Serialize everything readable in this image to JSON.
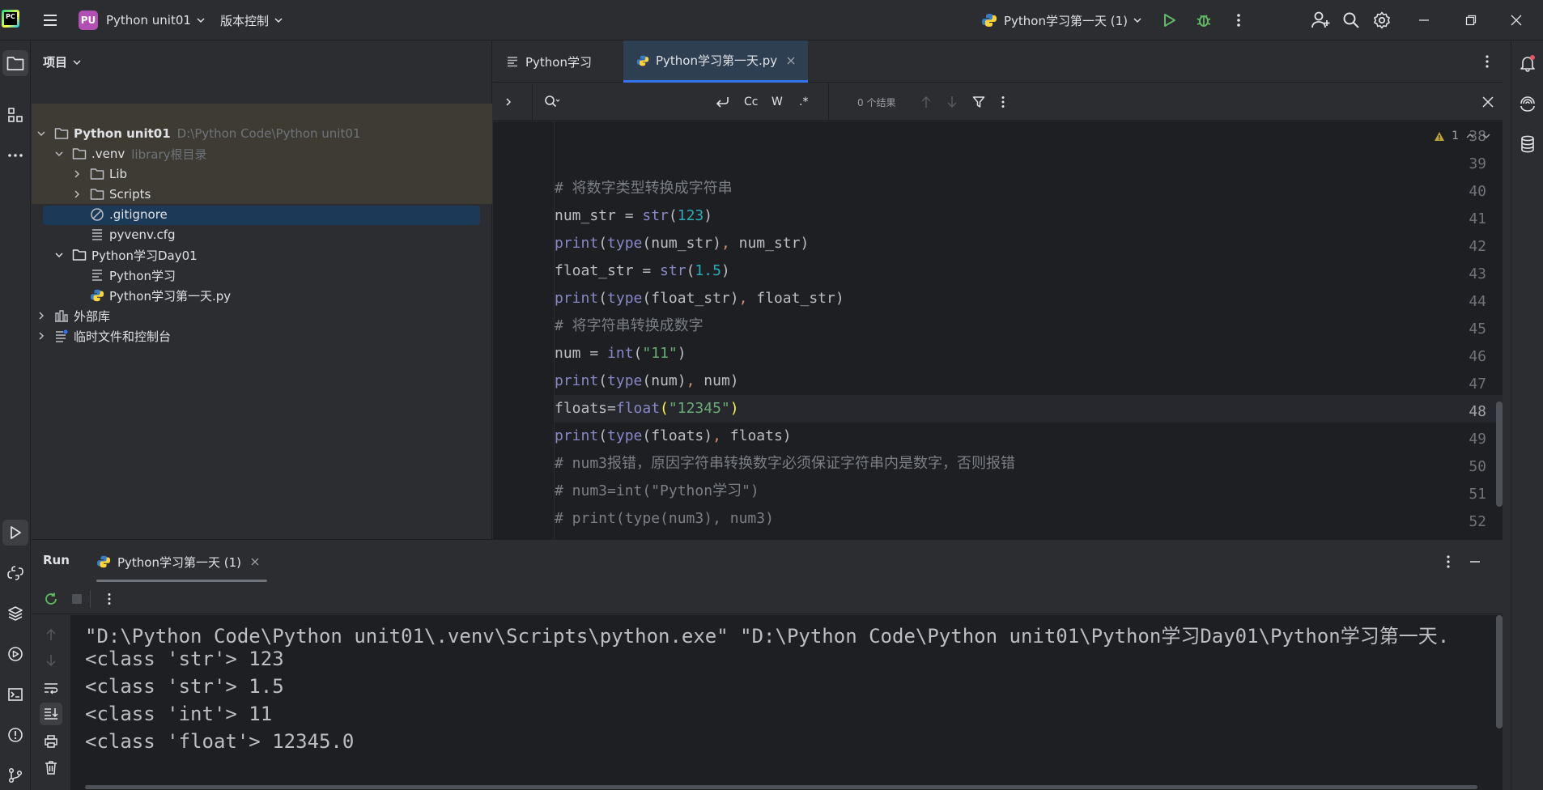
{
  "titlebar": {
    "logo_text": "PC",
    "project_badge": "PU",
    "project_name": "Python unit01",
    "vcs_menu": "版本控制",
    "run_config": "Python学习第一天 (1)"
  },
  "project_panel": {
    "header": "项目",
    "tree": [
      {
        "label": "Python unit01",
        "hint": "D:\\Python Code\\Python unit01"
      },
      {
        "label": ".venv",
        "hint": "library根目录"
      },
      {
        "label": "Lib"
      },
      {
        "label": "Scripts"
      },
      {
        "label": ".gitignore"
      },
      {
        "label": "pyvenv.cfg"
      },
      {
        "label": "Python学习Day01"
      },
      {
        "label": "Python学习"
      },
      {
        "label": "Python学习第一天.py"
      },
      {
        "label": "外部库"
      },
      {
        "label": "临时文件和控制台"
      }
    ]
  },
  "tabs": [
    {
      "label": "Python学习"
    },
    {
      "label": "Python学习第一天.py"
    }
  ],
  "findbar": {
    "case_label": "Cc",
    "word_label": "W",
    "regex_label": ".*",
    "results": "0 个结果"
  },
  "editor": {
    "warning_count": "1",
    "line_numbers": [
      "38",
      "39",
      "40",
      "41",
      "42",
      "43",
      "44",
      "45",
      "46",
      "47",
      "48",
      "49",
      "50",
      "51",
      "52"
    ],
    "current_line": "48",
    "lines": {
      "l40": "# 将数字类型转换成字符串",
      "l41": [
        "num_str = ",
        "str",
        "(",
        "123",
        ")"
      ],
      "l42": [
        "print",
        "(",
        "type",
        "(num_str)",
        ", ",
        "num_str)"
      ],
      "l43": [
        "float_str = ",
        "str",
        "(",
        "1.5",
        ")"
      ],
      "l44": [
        "print",
        "(",
        "type",
        "(float_str)",
        ", ",
        "float_str)"
      ],
      "l45": "# 将字符串转换成数字",
      "l46": [
        "num = ",
        "int",
        "(",
        "\"11\"",
        ")"
      ],
      "l47": [
        "print",
        "(",
        "type",
        "(num)",
        ", ",
        "num)"
      ],
      "l48": [
        "floats=",
        "float",
        "(",
        "\"12345\"",
        ")"
      ],
      "l49": [
        "print",
        "(",
        "type",
        "(floats)",
        ", ",
        "floats)"
      ],
      "l50": "# num3报错，原因字符串转换数字必须保证字符串内是数字，否则报错",
      "l51": "# num3=int(\"Python学习\")",
      "l52": "# print(type(num3), num3)"
    }
  },
  "run_panel": {
    "title": "Run",
    "tab_label": "Python学习第一天 (1)",
    "output": [
      "\"D:\\Python Code\\Python unit01\\.venv\\Scripts\\python.exe\" \"D:\\Python Code\\Python unit01\\Python学习Day01\\Python学习第一天.",
      "<class 'str'> 123",
      "<class 'str'> 1.5",
      "<class 'int'> 11",
      "<class 'float'> 12345.0"
    ]
  },
  "colors": {
    "accent": "#3574f0",
    "background": "#2b2d30",
    "editor_bg": "#1e1f22",
    "selection": "#1c3a58",
    "run_green": "#5fb865",
    "project_badge": "#b24fb2"
  },
  "icons": [
    "menu-icon",
    "run-icon",
    "debug-icon",
    "more-icon",
    "add-user-icon",
    "search-icon",
    "settings-icon",
    "minimize-icon",
    "restore-icon",
    "close-icon",
    "folder-icon",
    "python-file-icon",
    "text-file-icon",
    "gitignore-icon",
    "bell-icon",
    "database-icon"
  ]
}
